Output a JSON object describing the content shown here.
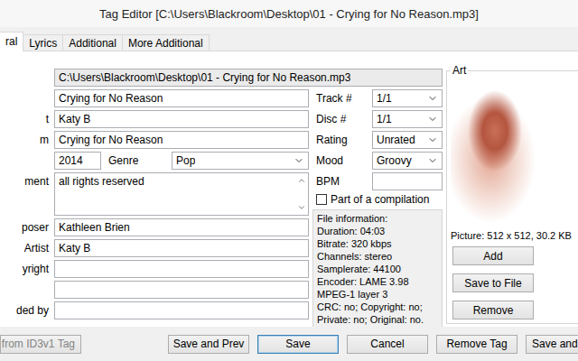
{
  "window": {
    "title": "Tag Editor [C:\\Users\\Blackroom\\Desktop\\01 - Crying for No Reason.mp3]"
  },
  "tabs": [
    {
      "label": "ral",
      "selected": true
    },
    {
      "label": "Lyrics",
      "selected": false
    },
    {
      "label": "Additional",
      "selected": false
    },
    {
      "label": "More Additional",
      "selected": false
    }
  ],
  "path": {
    "label": "",
    "value": "C:\\Users\\Blackroom\\Desktop\\01 - Crying for No Reason.mp3"
  },
  "fields": [
    {
      "label": "",
      "value": "Crying for No Reason",
      "kind": "text"
    },
    {
      "label": "t",
      "value": "Katy B",
      "kind": "text"
    },
    {
      "label": "m",
      "value": "Crying for No Reason",
      "kind": "text"
    },
    {
      "label": "",
      "value": "2014",
      "kind": "year",
      "genre_label": "Genre",
      "genre": "Pop"
    },
    {
      "label": "ment",
      "value": "all rights reserved",
      "kind": "textarea"
    },
    {
      "label": "poser",
      "value": "Kathleen Brien",
      "kind": "text"
    },
    {
      "label": "Artist",
      "value": "Katy B",
      "kind": "text"
    },
    {
      "label": "yright",
      "value": "",
      "kind": "text"
    },
    {
      "label": "",
      "value": "",
      "kind": "text"
    },
    {
      "label": "ded by",
      "value": "",
      "kind": "text"
    }
  ],
  "right_fields": [
    {
      "label": "Track #",
      "value": "1/1",
      "kind": "select"
    },
    {
      "label": "Disc #",
      "value": "1/1",
      "kind": "select"
    },
    {
      "label": "Rating",
      "value": "Unrated",
      "kind": "select"
    },
    {
      "label": "Mood",
      "value": "Groovy",
      "kind": "select"
    },
    {
      "label": "BPM",
      "value": "",
      "kind": "text"
    }
  ],
  "compilation": {
    "label": "Part of a compilation",
    "checked": false
  },
  "file_info": {
    "title": "File information:",
    "lines": [
      "Duration: 04:03",
      "Bitrate: 320 kbps",
      "Channels: stereo",
      "Samplerate: 44100",
      "Encoder: LAME 3.98",
      "MPEG-1 layer 3",
      "CRC: no; Copyright: no;",
      "Private: no; Original: no."
    ]
  },
  "art": {
    "title": "Art",
    "picture_info": "Picture: 512 x 512, 30.2 KB",
    "buttons": [
      "Add",
      "Save to File",
      "Remove"
    ]
  },
  "bottom_buttons": [
    {
      "label": "from ID3v1 Tag",
      "disabled": true,
      "default": false
    },
    {
      "label": "Save and Prev",
      "disabled": false,
      "default": false
    },
    {
      "label": "Save",
      "disabled": false,
      "default": true
    },
    {
      "label": "Cancel",
      "disabled": false,
      "default": false
    },
    {
      "label": "Remove Tag",
      "disabled": false,
      "default": false
    },
    {
      "label": "Save and",
      "disabled": false,
      "default": false
    }
  ]
}
